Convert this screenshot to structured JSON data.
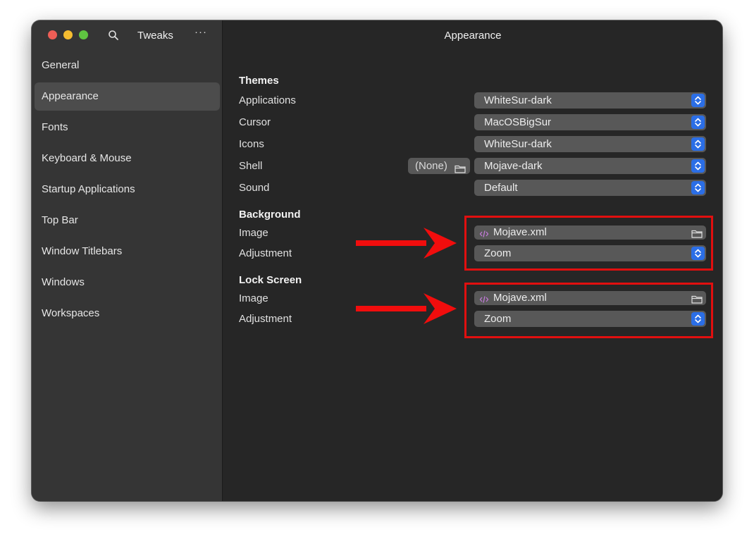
{
  "window": {
    "sidebar_title": "Tweaks",
    "main_title": "Appearance",
    "more_label": "···"
  },
  "sidebar": {
    "items": [
      {
        "label": "General",
        "active": false
      },
      {
        "label": "Appearance",
        "active": true
      },
      {
        "label": "Fonts",
        "active": false
      },
      {
        "label": "Keyboard & Mouse",
        "active": false
      },
      {
        "label": "Startup Applications",
        "active": false
      },
      {
        "label": "Top Bar",
        "active": false
      },
      {
        "label": "Window Titlebars",
        "active": false
      },
      {
        "label": "Windows",
        "active": false
      },
      {
        "label": "Workspaces",
        "active": false
      }
    ]
  },
  "themes": {
    "title": "Themes",
    "applications": {
      "label": "Applications",
      "value": "WhiteSur-dark"
    },
    "cursor": {
      "label": "Cursor",
      "value": "MacOSBigSur"
    },
    "icons": {
      "label": "Icons",
      "value": "WhiteSur-dark"
    },
    "shell": {
      "label": "Shell",
      "value": "Mojave-dark",
      "file_button": "(None)"
    },
    "sound": {
      "label": "Sound",
      "value": "Default"
    }
  },
  "background": {
    "title": "Background",
    "image": {
      "label": "Image",
      "file": "Mojave.xml"
    },
    "adjustment": {
      "label": "Adjustment",
      "value": "Zoom"
    }
  },
  "lock_screen": {
    "title": "Lock Screen",
    "image": {
      "label": "Image",
      "file": "Mojave.xml"
    },
    "adjustment": {
      "label": "Adjustment",
      "value": "Zoom"
    }
  },
  "colors": {
    "accent": "#2b6ee6",
    "annotation": "#e10f0f",
    "traffic_close": "#ed5e56",
    "traffic_min": "#f5bd30",
    "traffic_max": "#5fc441"
  },
  "icons": {
    "search": "search-icon",
    "more": "more-icon",
    "chevron": "updown-chevron-icon",
    "folder": "folder-icon",
    "xml": "code-file-icon"
  }
}
